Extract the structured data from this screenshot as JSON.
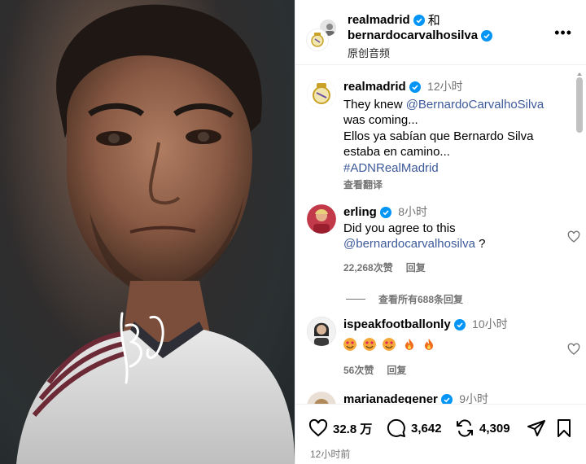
{
  "header": {
    "user1": "realmadrid",
    "conjunction": "和",
    "user2": "bernardocarvalhosilva",
    "audio_label": "原创音频",
    "more_label": "•••"
  },
  "caption": {
    "username": "realmadrid",
    "time": "12小时",
    "line1_prefix": "They knew ",
    "line1_mention": "@BernardoCarvalhoSilva",
    "line2": "was coming...",
    "line3": "Ellos ya sabían que Bernardo Silva",
    "line4": "estaba en camino...",
    "hashtag": "#ADNRealMadrid",
    "translate": "查看翻译"
  },
  "comments": [
    {
      "username": "erling",
      "time": "8小时",
      "text_line1": "Did you agree to this",
      "mention": "@bernardocarvalhosilva",
      "mention_suffix": " ?",
      "likes": "22,268次赞",
      "reply": "回复"
    },
    {
      "username": "ispeakfootballonly",
      "time": "10小时",
      "likes": "56次赞",
      "reply": "回复"
    },
    {
      "username": "marianadegener",
      "time": "9小时"
    }
  ],
  "view_replies": "查看所有688条回复",
  "actions": {
    "likes": "32.8 万",
    "comments": "3,642",
    "reposts": "4,309"
  },
  "timestamp": "12小时前",
  "colors": {
    "verified": "#0095f6",
    "mention": "#3d5a9a",
    "muted": "#737373"
  }
}
